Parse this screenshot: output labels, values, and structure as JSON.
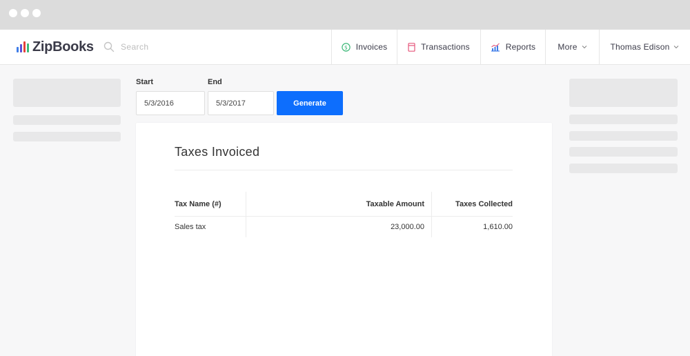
{
  "window": {
    "controls": [
      "close",
      "minimize",
      "maximize"
    ]
  },
  "brand": {
    "name": "ZipBooks",
    "bar_colors": [
      "#3f7de8",
      "#5b4fd6",
      "#e5403a",
      "#3cb878"
    ]
  },
  "search": {
    "placeholder": "Search",
    "icon": "search-icon"
  },
  "nav": {
    "invoices": {
      "label": "Invoices",
      "icon": "dollar-circle-icon",
      "color": "#3cb878"
    },
    "transactions": {
      "label": "Transactions",
      "icon": "ledger-icon",
      "color": "#e5557a"
    },
    "reports": {
      "label": "Reports",
      "icon": "chart-icon",
      "color": "#3f7de8"
    },
    "more": {
      "label": "More",
      "icon": "chevron-down-icon"
    },
    "user": {
      "label": "Thomas Edison",
      "icon": "chevron-down-icon"
    }
  },
  "filters": {
    "start_label": "Start",
    "start_value": "5/3/2016",
    "end_label": "End",
    "end_value": "5/3/2017",
    "generate_label": "Generate",
    "button_color": "#0d6efd"
  },
  "report": {
    "title": "Taxes Invoiced",
    "columns": [
      "Tax Name (#)",
      "Taxable Amount",
      "Taxes Collected"
    ],
    "rows": [
      {
        "name": "Sales tax",
        "taxable_amount": "23,000.00",
        "taxes_collected": "1,610.00"
      }
    ]
  }
}
